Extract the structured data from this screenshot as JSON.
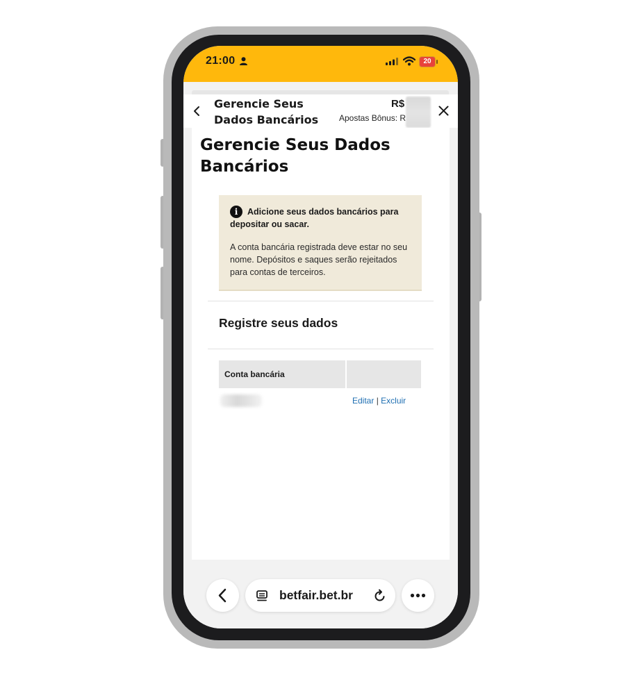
{
  "status_bar": {
    "time": "21:00",
    "battery_level": "20",
    "icons": [
      "person-icon",
      "cellular-signal-icon",
      "wifi-icon",
      "battery-icon"
    ],
    "bar_color": "#ffb80c"
  },
  "header": {
    "title": "Gerencie Seus Dados Bancários",
    "balance_label": "R$",
    "bonus_label": "Apostas Bônus: R",
    "back_icon": "chevron-left-icon",
    "close_icon": "close-icon"
  },
  "main": {
    "page_title": "Gerencie Seus Dados Bancários",
    "info_box": {
      "icon": "info-icon",
      "icon_glyph": "i",
      "heading": "Adicione seus dados bancários para depositar ou sacar.",
      "body": "A conta bancária registrada deve estar no seu nome. Depósitos e saques serão rejeitados para contas de terceiros.",
      "background": "#f0eada"
    },
    "section_title": "Registre seus dados",
    "table": {
      "columns": [
        "Conta bancária",
        ""
      ],
      "rows": [
        {
          "account": "",
          "edit_label": "Editar",
          "separator": "|",
          "delete_label": "Excluir"
        }
      ]
    },
    "link_color": "#1f6fb2"
  },
  "browser_bar": {
    "url": "betfair.bet.br",
    "back_icon": "chevron-left-icon",
    "reader_icon": "reader-mode-icon",
    "reload_icon": "reload-icon",
    "more_icon": "more-horizontal-icon"
  }
}
